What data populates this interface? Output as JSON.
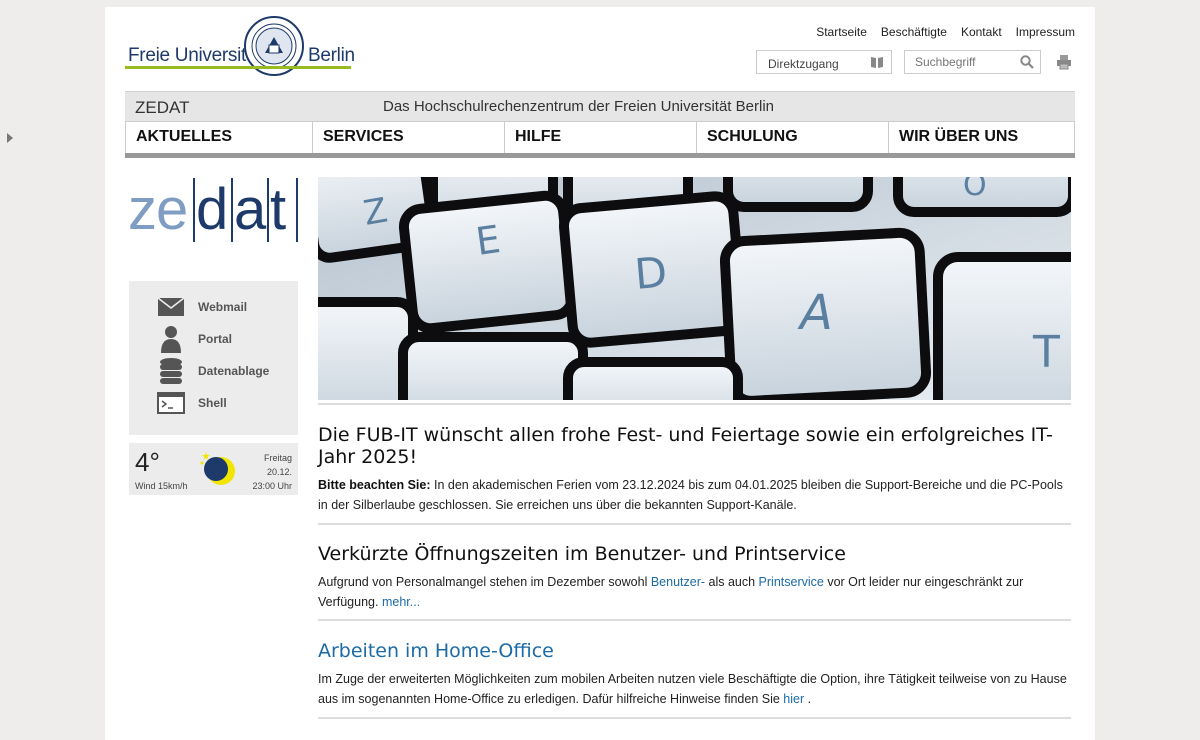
{
  "header": {
    "logo_left": "Freie Universität",
    "logo_right": "Berlin",
    "top_nav": [
      "Startseite",
      "Beschäftigte",
      "Kontakt",
      "Impressum"
    ],
    "direktzugang": "Direktzugang",
    "search_placeholder": "Suchbegriff"
  },
  "banner": {
    "title": "ZEDAT",
    "subtitle": "Das Hochschulrechenzentrum der Freien Universität Berlin"
  },
  "main_nav": [
    "AKTUELLES",
    "SERVICES",
    "HILFE",
    "SCHULUNG",
    "WIR ÜBER UNS"
  ],
  "sidebar": {
    "brand": [
      "ze",
      "d",
      "a",
      "t"
    ],
    "quick_links": [
      {
        "label": "Webmail",
        "icon": "mail-icon"
      },
      {
        "label": "Portal",
        "icon": "user-icon"
      },
      {
        "label": "Datenablage",
        "icon": "database-icon"
      },
      {
        "label": "Shell",
        "icon": "terminal-icon"
      }
    ],
    "weather": {
      "temperature": "4°",
      "wind": "Wind 15km/h",
      "day": "Freitag",
      "date": "20.12.",
      "time": "23:00 Uhr"
    }
  },
  "hero": {
    "keys": [
      "Z",
      "E",
      "D",
      "A",
      "T",
      "O"
    ]
  },
  "news": [
    {
      "title": "Die FUB-IT wünscht allen frohe Fest- und Feiertage sowie ein erfolgreiches IT-Jahr 2025!",
      "bold": "Bitte beachten Sie:",
      "text": " In den akademischen Ferien vom 23.12.2024 bis zum 04.01.2025 bleiben die Support-Bereiche und die PC-Pools in der Silberlaube geschlossen. Sie erreichen uns über die bekannten Support-Kanäle."
    },
    {
      "title": "Verkürzte Öffnungszeiten im Benutzer- und Printservice",
      "text1": "Aufgrund von Personalmangel stehen im Dezember sowohl ",
      "link1": "Benutzer-",
      "text2": " als auch ",
      "link2": "Printservice",
      "text3": " vor Ort leider nur eingeschränkt zur Verfügung. ",
      "link3": "mehr..."
    },
    {
      "title": "Arbeiten im Home-Office",
      "text1": "Im Zuge der erweiterten Möglichkeiten zum mobilen Arbeiten nutzen viele Beschäftigte die Option, ihre Tätigkeit teilweise von zu Hause aus im sogenannten Home-Office zu erledigen. Dafür hilfreiche Hinweise finden Sie ",
      "link1": "hier",
      "text2": " ."
    }
  ],
  "colors": {
    "brand_blue": "#1d3a6b",
    "brand_green": "#99bb22",
    "link_blue": "#1c6ba6"
  }
}
